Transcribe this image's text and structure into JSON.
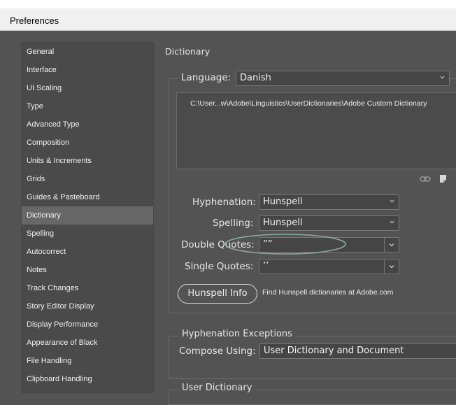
{
  "window": {
    "title": "Preferences"
  },
  "sidebar": {
    "items": [
      {
        "label": "General"
      },
      {
        "label": "Interface"
      },
      {
        "label": "UI Scaling"
      },
      {
        "label": "Type"
      },
      {
        "label": "Advanced Type"
      },
      {
        "label": "Composition"
      },
      {
        "label": "Units & Increments"
      },
      {
        "label": "Grids"
      },
      {
        "label": "Guides & Pasteboard"
      },
      {
        "label": "Dictionary"
      },
      {
        "label": "Spelling"
      },
      {
        "label": "Autocorrect"
      },
      {
        "label": "Notes"
      },
      {
        "label": "Track Changes"
      },
      {
        "label": "Story Editor Display"
      },
      {
        "label": "Display Performance"
      },
      {
        "label": "Appearance of Black"
      },
      {
        "label": "File Handling"
      },
      {
        "label": "Clipboard Handling"
      }
    ],
    "selected": "Dictionary"
  },
  "dictionary": {
    "section_title": "Dictionary",
    "language_label": "Language:",
    "language_value": "Danish",
    "dictionary_path": "C:\\User...w\\Adobe\\Linguistics\\UserDictionaries\\Adobe Custom Dictionary",
    "hyphenation_label": "Hyphenation:",
    "hyphenation_value": "Hunspell",
    "spelling_label": "Spelling:",
    "spelling_value": "Hunspell",
    "double_quotes_label": "Double Quotes:",
    "double_quotes_value": "””",
    "single_quotes_label": "Single Quotes:",
    "single_quotes_value": "’’",
    "hunspell_info_button": "Hunspell Info",
    "hunspell_hint": "Find Hunspell dictionaries at Adobe.com"
  },
  "hyphenation_exceptions": {
    "title": "Hyphenation Exceptions",
    "compose_label": "Compose Using:",
    "compose_value": "User Dictionary and Document"
  },
  "user_dictionary": {
    "title": "User Dictionary"
  },
  "colors": {
    "background": "#535353",
    "sidebar_bg": "#4a4a4a",
    "selected_bg": "#676767",
    "annotation_ellipse": "#8aa8a0"
  },
  "icons": [
    "chain-link-icon",
    "new-dictionary-icon",
    "chevron-down-icon"
  ]
}
